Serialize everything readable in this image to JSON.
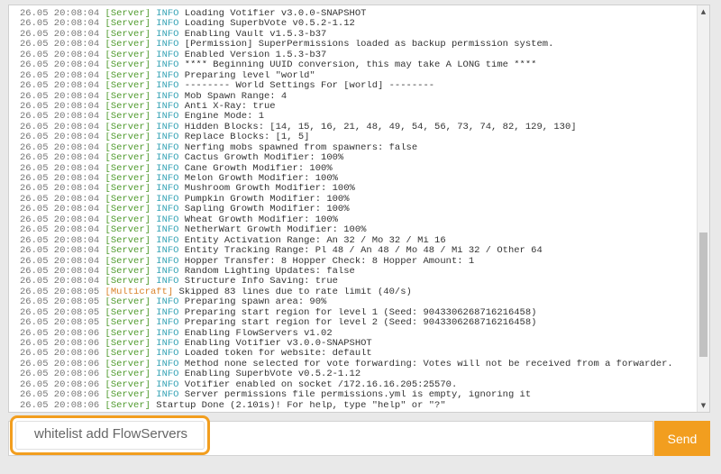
{
  "console": {
    "lines": [
      {
        "ts": "26.05 20:08:04",
        "src": "[Server]",
        "lvl": "INFO",
        "msg": "Loading Votifier v3.0.0-SNAPSHOT"
      },
      {
        "ts": "26.05 20:08:04",
        "src": "[Server]",
        "lvl": "INFO",
        "msg": "Loading SuperbVote v0.5.2-1.12"
      },
      {
        "ts": "26.05 20:08:04",
        "src": "[Server]",
        "lvl": "INFO",
        "msg": "Enabling Vault v1.5.3-b37"
      },
      {
        "ts": "26.05 20:08:04",
        "src": "[Server]",
        "lvl": "INFO",
        "msg": "[Permission] SuperPermissions loaded as backup permission system."
      },
      {
        "ts": "26.05 20:08:04",
        "src": "[Server]",
        "lvl": "INFO",
        "msg": "Enabled Version 1.5.3-b37"
      },
      {
        "ts": "26.05 20:08:04",
        "src": "[Server]",
        "lvl": "INFO",
        "msg": "**** Beginning UUID conversion, this may take A LONG time ****"
      },
      {
        "ts": "26.05 20:08:04",
        "src": "[Server]",
        "lvl": "INFO",
        "msg": "Preparing level \"world\""
      },
      {
        "ts": "26.05 20:08:04",
        "src": "[Server]",
        "lvl": "INFO",
        "msg": "-------- World Settings For [world] --------"
      },
      {
        "ts": "26.05 20:08:04",
        "src": "[Server]",
        "lvl": "INFO",
        "msg": "Mob Spawn Range: 4"
      },
      {
        "ts": "26.05 20:08:04",
        "src": "[Server]",
        "lvl": "INFO",
        "msg": "Anti X-Ray: true"
      },
      {
        "ts": "26.05 20:08:04",
        "src": "[Server]",
        "lvl": "INFO",
        "msg": "Engine Mode: 1"
      },
      {
        "ts": "26.05 20:08:04",
        "src": "[Server]",
        "lvl": "INFO",
        "msg": "Hidden Blocks: [14, 15, 16, 21, 48, 49, 54, 56, 73, 74, 82, 129, 130]"
      },
      {
        "ts": "26.05 20:08:04",
        "src": "[Server]",
        "lvl": "INFO",
        "msg": "Replace Blocks: [1, 5]"
      },
      {
        "ts": "26.05 20:08:04",
        "src": "[Server]",
        "lvl": "INFO",
        "msg": "Nerfing mobs spawned from spawners: false"
      },
      {
        "ts": "26.05 20:08:04",
        "src": "[Server]",
        "lvl": "INFO",
        "msg": "Cactus Growth Modifier: 100%"
      },
      {
        "ts": "26.05 20:08:04",
        "src": "[Server]",
        "lvl": "INFO",
        "msg": "Cane Growth Modifier: 100%"
      },
      {
        "ts": "26.05 20:08:04",
        "src": "[Server]",
        "lvl": "INFO",
        "msg": "Melon Growth Modifier: 100%"
      },
      {
        "ts": "26.05 20:08:04",
        "src": "[Server]",
        "lvl": "INFO",
        "msg": "Mushroom Growth Modifier: 100%"
      },
      {
        "ts": "26.05 20:08:04",
        "src": "[Server]",
        "lvl": "INFO",
        "msg": "Pumpkin Growth Modifier: 100%"
      },
      {
        "ts": "26.05 20:08:04",
        "src": "[Server]",
        "lvl": "INFO",
        "msg": "Sapling Growth Modifier: 100%"
      },
      {
        "ts": "26.05 20:08:04",
        "src": "[Server]",
        "lvl": "INFO",
        "msg": "Wheat Growth Modifier: 100%"
      },
      {
        "ts": "26.05 20:08:04",
        "src": "[Server]",
        "lvl": "INFO",
        "msg": "NetherWart Growth Modifier: 100%"
      },
      {
        "ts": "26.05 20:08:04",
        "src": "[Server]",
        "lvl": "INFO",
        "msg": "Entity Activation Range: An 32 / Mo 32 / Mi 16"
      },
      {
        "ts": "26.05 20:08:04",
        "src": "[Server]",
        "lvl": "INFO",
        "msg": "Entity Tracking Range: Pl 48 / An 48 / Mo 48 / Mi 32 / Other 64"
      },
      {
        "ts": "26.05 20:08:04",
        "src": "[Server]",
        "lvl": "INFO",
        "msg": "Hopper Transfer: 8 Hopper Check: 8 Hopper Amount: 1"
      },
      {
        "ts": "26.05 20:08:04",
        "src": "[Server]",
        "lvl": "INFO",
        "msg": "Random Lighting Updates: false"
      },
      {
        "ts": "26.05 20:08:04",
        "src": "[Server]",
        "lvl": "INFO",
        "msg": "Structure Info Saving: true"
      },
      {
        "ts": "26.05 20:08:05",
        "src": "[Multicraft]",
        "lvl": "",
        "msg": "Skipped 83 lines due to rate limit (40/s)"
      },
      {
        "ts": "26.05 20:08:05",
        "src": "[Server]",
        "lvl": "INFO",
        "msg": "Preparing spawn area: 90%"
      },
      {
        "ts": "26.05 20:08:05",
        "src": "[Server]",
        "lvl": "INFO",
        "msg": "Preparing start region for level 1 (Seed: 9043306268716216458)"
      },
      {
        "ts": "26.05 20:08:05",
        "src": "[Server]",
        "lvl": "INFO",
        "msg": "Preparing start region for level 2 (Seed: 9043306268716216458)"
      },
      {
        "ts": "26.05 20:08:06",
        "src": "[Server]",
        "lvl": "INFO",
        "msg": "Enabling FlowServers v1.02"
      },
      {
        "ts": "26.05 20:08:06",
        "src": "[Server]",
        "lvl": "INFO",
        "msg": "Enabling Votifier v3.0.0-SNAPSHOT"
      },
      {
        "ts": "26.05 20:08:06",
        "src": "[Server]",
        "lvl": "INFO",
        "msg": "Loaded token for website: default"
      },
      {
        "ts": "26.05 20:08:06",
        "src": "[Server]",
        "lvl": "INFO",
        "msg": "Method none selected for vote forwarding: Votes will not be received from a forwarder."
      },
      {
        "ts": "26.05 20:08:06",
        "src": "[Server]",
        "lvl": "INFO",
        "msg": "Enabling SuperbVote v0.5.2-1.12"
      },
      {
        "ts": "26.05 20:08:06",
        "src": "[Server]",
        "lvl": "INFO",
        "msg": "Votifier enabled on socket /172.16.16.205:25570."
      },
      {
        "ts": "26.05 20:08:06",
        "src": "[Server]",
        "lvl": "INFO",
        "msg": "Server permissions file permissions.yml is empty, ignoring it"
      },
      {
        "ts": "26.05 20:08:06",
        "src": "[Server]",
        "lvl": "",
        "msg": "Startup Done (2.101s)! For help, type \"help\" or \"?\""
      }
    ]
  },
  "command": {
    "value": "whitelist add FlowServers"
  },
  "send_button": {
    "label": "Send"
  },
  "colors": {
    "accent": "#f29e1f",
    "server_source": "#4f9a2d",
    "multicraft_source": "#d9822b",
    "info_level": "#35a3b5",
    "timestamp": "#777777"
  },
  "icons": {
    "scroll_up": "scroll-up-arrow-icon",
    "scroll_down": "scroll-down-arrow-icon"
  }
}
